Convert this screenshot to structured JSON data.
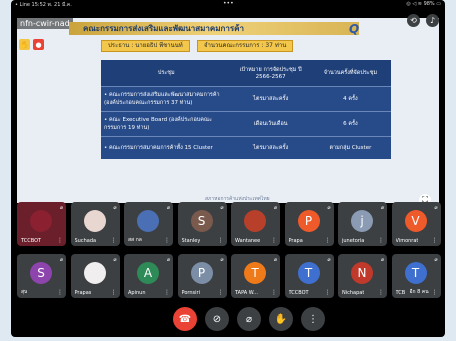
{
  "status_bar": {
    "left": "• Line 15:52 พ. 21 มี.ค.",
    "center": "•••",
    "right": "◎ ◁ ≋ 98% ▭"
  },
  "meeting": {
    "code": "nfn-cwir-nad"
  },
  "slide": {
    "title": "คณะกรรมการส่งเสริมและพัฒนาสมาคมการค้า",
    "logo": "Q",
    "pill_left": "ประธาน : นายอธิป พีชานนท์",
    "pill_right": "จำนวนคณะกรรมการ : 37 ท่าน",
    "headers": [
      "ประชุม",
      "เป้าหมาย การจัดประชุม ปี 2566-2567",
      "จำนวนครั้งที่จัดประชุม"
    ],
    "rows": [
      [
        "• คณะกรรมการส่งเสริมและพัฒนาสมาคมการค้า (องค์ประกอบคณะกรรมการ 37 ท่าน)",
        "ไตรมาสละครั้ง",
        "4 ครั้ง"
      ],
      [
        "• คณะ Executive Board (องค์ประกอบคณะกรรมการ 19 ท่าน)",
        "เดือนเว้นเดือน",
        "6 ครั้ง"
      ],
      [
        "• คณะกรรมการสมาคมการค้าทั้ง 15 Cluster",
        "ไตรมาสละครั้ง",
        "ตามกลุ่ม Cluster"
      ]
    ],
    "footer": "สภาหอการค้าแห่งประเทศไทย"
  },
  "participants": [
    {
      "name": "TCCBOT",
      "initial": "",
      "color": "#8a2030"
    },
    {
      "name": "Suchada",
      "initial": "",
      "color": "#e8d6d0"
    },
    {
      "name": "สส กล",
      "initial": "",
      "color": "#4a6fb5"
    },
    {
      "name": "Stanley",
      "initial": "S",
      "color": "#7b5a4e"
    },
    {
      "name": "Wantanee",
      "initial": "",
      "color": "#b8402a"
    },
    {
      "name": "Prapa",
      "initial": "P",
      "color": "#ee5a2a"
    },
    {
      "name": "junetoria",
      "initial": "j",
      "color": "#8a9bb3"
    },
    {
      "name": "Vimonrat",
      "initial": "V",
      "color": "#ee5a2a"
    },
    {
      "name": "สุน",
      "initial": "S",
      "color": "#8e44ad"
    },
    {
      "name": "Prapas",
      "initial": "",
      "color": "#f0eeee"
    },
    {
      "name": "Apinun",
      "initial": "A",
      "color": "#2e8b57"
    },
    {
      "name": "Pornsiri",
      "initial": "P",
      "color": "#7b8ea6"
    },
    {
      "name": "TAPA W...",
      "initial": "T",
      "color": "#ee7a1a"
    },
    {
      "name": "TCCBOT",
      "initial": "T",
      "color": "#3f6fcf"
    },
    {
      "name": "Nichapat",
      "initial": "N",
      "color": "#c0392b"
    },
    {
      "name": "TCB",
      "initial": "T",
      "color": "#3f6fcf"
    }
  ],
  "more_count": "อีก 8 คน"
}
